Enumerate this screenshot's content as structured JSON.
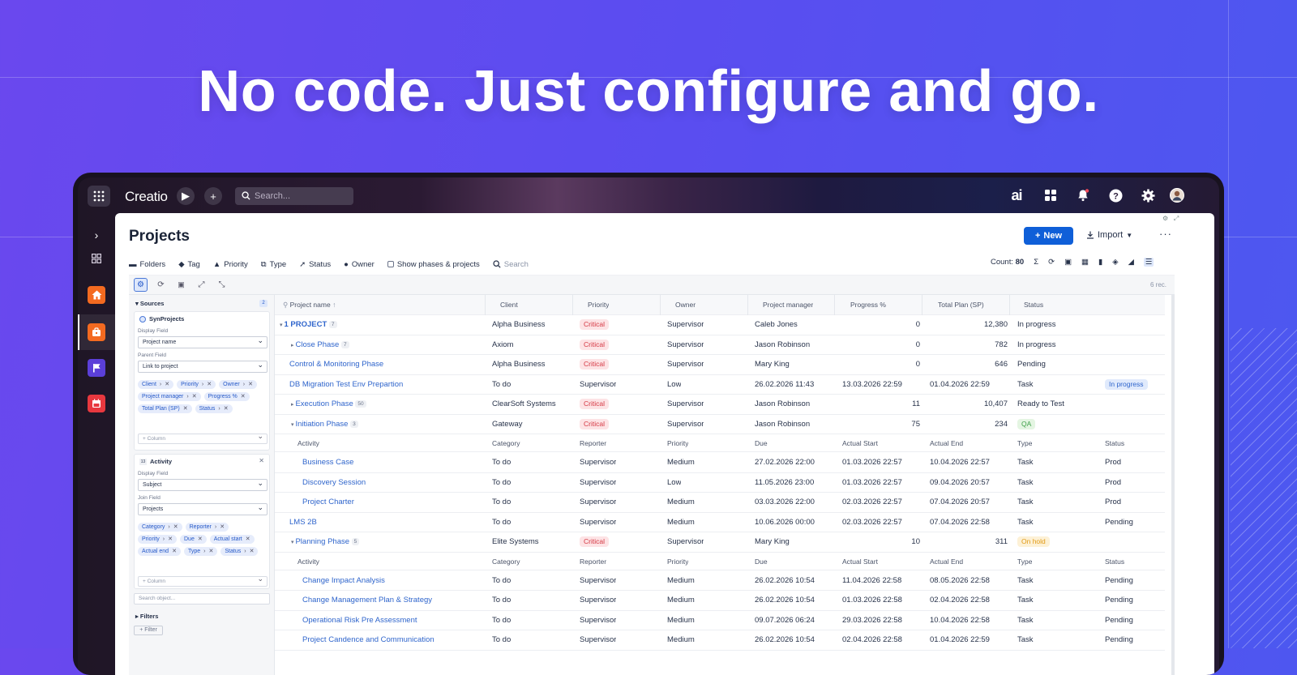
{
  "headline": "No code. Just configure and go.",
  "app": {
    "logo": "Creatio",
    "search_placeholder": "Search...",
    "ai_label": "ai"
  },
  "page": {
    "title": "Projects",
    "new_label": "New",
    "import_label": "Import"
  },
  "filters": {
    "folders": "Folders",
    "tag": "Tag",
    "priority": "Priority",
    "type": "Type",
    "status": "Status",
    "owner": "Owner",
    "show_phases": "Show phases & projects",
    "search": "Search",
    "count_label": "Count:",
    "count_value": "80"
  },
  "records_label": "6 rec.",
  "config": {
    "sources_title": "Sources",
    "sources_count": "2",
    "source1": {
      "name": "SynProjects",
      "display_field_label": "Display Field",
      "display_field_value": "Project name",
      "parent_field_label": "Parent Field",
      "parent_field_value": "Link to project",
      "chips": [
        "Client",
        "Priority",
        "Owner",
        "Project manager",
        "Progress %",
        "Total Plan (SP)",
        "Status"
      ],
      "column_placeholder": "+ Column"
    },
    "source2": {
      "name": "Activity",
      "display_field_label": "Display Field",
      "display_field_value": "Subject",
      "join_field_label": "Join Field",
      "join_field_value": "Projects",
      "chips": [
        "Category",
        "Reporter",
        "Priority",
        "Due",
        "Actual start",
        "Actual end",
        "Type",
        "Status"
      ],
      "column_placeholder": "+ Column"
    },
    "search_object": "Search object...",
    "filters_title": "Filters",
    "filter_button": "+ Filter"
  },
  "grid": {
    "columns": [
      "Project name",
      "Client",
      "Priority",
      "Owner",
      "Project manager",
      "Progress %",
      "Total Plan (SP)",
      "Status"
    ],
    "sub_columns": [
      "Activity",
      "Category",
      "Reporter",
      "Priority",
      "Due",
      "Actual Start",
      "Actual End",
      "Type",
      "Status"
    ],
    "rows": [
      {
        "kind": "project",
        "level": 0,
        "expand": "▾",
        "name": "1 PROJECT",
        "count": "7",
        "client": "Alpha Business",
        "priority": "Critical",
        "owner": "Supervisor",
        "manager": "Caleb Jones",
        "progress": "0",
        "plan": "12,380",
        "status": "In progress"
      },
      {
        "kind": "project",
        "level": 1,
        "expand": "▸",
        "name": "Close Phase",
        "count": "7",
        "client": "Axiom",
        "priority": "Critical",
        "owner": "Supervisor",
        "manager": "Jason Robinson",
        "progress": "0",
        "plan": "782",
        "status": "In progress"
      },
      {
        "kind": "project",
        "level": 1,
        "expand": "",
        "name": "Control & Monitoring Phase",
        "count": "",
        "client": "Alpha Business",
        "priority": "Critical",
        "owner": "Supervisor",
        "manager": "Mary King",
        "progress": "0",
        "plan": "646",
        "status": "Pending"
      },
      {
        "kind": "activity",
        "level": 1,
        "name": "DB Migration Test Env Prepartion",
        "category": "To do",
        "reporter": "Supervisor",
        "priority": "Low",
        "due": "26.02.2026 11:43",
        "start": "13.03.2026 22:59",
        "end": "01.04.2026 22:59",
        "type": "Task",
        "status": "In progress"
      },
      {
        "kind": "project",
        "level": 1,
        "expand": "▸",
        "name": "Execution Phase",
        "count": "50",
        "client": "ClearSoft Systems",
        "priority": "Critical",
        "owner": "Supervisor",
        "manager": "Jason Robinson",
        "progress": "11",
        "plan": "10,407",
        "status": "Ready to Test"
      },
      {
        "kind": "project",
        "level": 1,
        "expand": "▾",
        "name": "Initiation Phase",
        "count": "3",
        "client": "Gateway",
        "priority": "Critical",
        "owner": "Supervisor",
        "manager": "Jason Robinson",
        "progress": "75",
        "plan": "234",
        "status": "QA"
      },
      {
        "kind": "subheader"
      },
      {
        "kind": "activity",
        "level": 2,
        "name": "Business Case",
        "category": "To do",
        "reporter": "Supervisor",
        "priority": "Medium",
        "due": "27.02.2026 22:00",
        "start": "01.03.2026 22:57",
        "end": "10.04.2026 22:57",
        "type": "Task",
        "status": "Prod"
      },
      {
        "kind": "activity",
        "level": 2,
        "name": "Discovery Session",
        "category": "To do",
        "reporter": "Supervisor",
        "priority": "Low",
        "due": "11.05.2026 23:00",
        "start": "01.03.2026 22:57",
        "end": "09.04.2026 20:57",
        "type": "Task",
        "status": "Prod"
      },
      {
        "kind": "activity",
        "level": 2,
        "name": "Project Charter",
        "category": "To do",
        "reporter": "Supervisor",
        "priority": "Medium",
        "due": "03.03.2026 22:00",
        "start": "02.03.2026 22:57",
        "end": "07.04.2026 20:57",
        "type": "Task",
        "status": "Prod"
      },
      {
        "kind": "activity",
        "level": 1,
        "name": "LMS 2B",
        "category": "To do",
        "reporter": "Supervisor",
        "priority": "Medium",
        "due": "10.06.2026 00:00",
        "start": "02.03.2026 22:57",
        "end": "07.04.2026 22:58",
        "type": "Task",
        "status": "Pending"
      },
      {
        "kind": "project",
        "level": 1,
        "expand": "▾",
        "name": "Planning Phase",
        "count": "5",
        "client": "Elite Systems",
        "priority": "Critical",
        "owner": "Supervisor",
        "manager": "Mary King",
        "progress": "10",
        "plan": "311",
        "status": "On hold"
      },
      {
        "kind": "subheader"
      },
      {
        "kind": "activity",
        "level": 2,
        "name": "Change Impact Analysis",
        "category": "To do",
        "reporter": "Supervisor",
        "priority": "Medium",
        "due": "26.02.2026 10:54",
        "start": "11.04.2026 22:58",
        "end": "08.05.2026 22:58",
        "type": "Task",
        "status": "Pending"
      },
      {
        "kind": "activity",
        "level": 2,
        "name": "Change Management Plan & Strategy",
        "category": "To do",
        "reporter": "Supervisor",
        "priority": "Medium",
        "due": "26.02.2026 10:54",
        "start": "01.03.2026 22:58",
        "end": "02.04.2026 22:58",
        "type": "Task",
        "status": "Pending"
      },
      {
        "kind": "activity",
        "level": 2,
        "name": "Operational Risk Pre Assessment",
        "category": "To do",
        "reporter": "Supervisor",
        "priority": "Medium",
        "due": "09.07.2026 06:24",
        "start": "29.03.2026 22:58",
        "end": "10.04.2026 22:58",
        "type": "Task",
        "status": "Pending"
      },
      {
        "kind": "activity",
        "level": 2,
        "name": "Project Candence and Communication",
        "category": "To do",
        "reporter": "Supervisor",
        "priority": "Medium",
        "due": "26.02.2026 10:54",
        "start": "02.04.2026 22:58",
        "end": "01.04.2026 22:59",
        "type": "Task",
        "status": "Pending"
      }
    ]
  },
  "colors": {
    "accent": "#0f5fd8",
    "critical": "#d53944",
    "link": "#2f65cc"
  }
}
